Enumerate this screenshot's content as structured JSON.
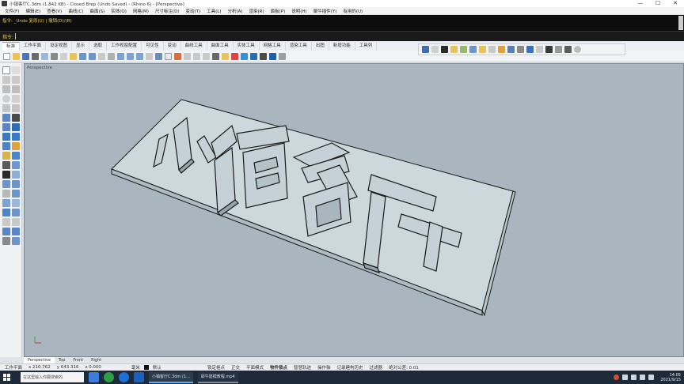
{
  "window": {
    "title": "小镇客厅C.3dm (1.842 KB) - Closed Brep (Undo Saved) - (Rhino 6) - [Perspective]",
    "minimize": "—",
    "maximize": "☐",
    "close": "✕"
  },
  "menu": [
    "文件(F)",
    "编辑(E)",
    "查看(V)",
    "曲线(C)",
    "曲面(S)",
    "实体(O)",
    "网格(M)",
    "尺寸标注(D)",
    "变动(T)",
    "工具(L)",
    "分析(A)",
    "渲染(R)",
    "面板(P)",
    "说明(H)",
    "犀牛插件(Y)",
    "有用的(U)"
  ],
  "command": {
    "history": "指令: _Undo 复原(U) | 撤销(D)/(R)",
    "prompt": "指令:"
  },
  "tabs": [
    "标准",
    "工作平面",
    "设定视图",
    "显示",
    "选取",
    "工作视窗配置",
    "可见性",
    "变动",
    "曲线工具",
    "曲面工具",
    "实体工具",
    "网格工具",
    "渲染工具",
    "出图",
    "新增功能",
    "工具列"
  ],
  "viewport": {
    "label": "Perspective",
    "tabs": [
      "Perspective",
      "Top",
      "Front",
      "Right"
    ]
  },
  "status": {
    "cplane": "工作平面",
    "x": "x 210.762",
    "y": "y 643.316",
    "z": "z 0.000",
    "units": "毫米",
    "layer": "默认",
    "toggles": [
      "锁定格点",
      "正交",
      "平面模式",
      "物件锁点",
      "智慧轨迹",
      "操作轴",
      "记录建构历史",
      "过滤器",
      "绝对公差: 0.01"
    ]
  },
  "taskbar": {
    "search": "在这里输入你要搜索的",
    "apps": [
      "小镇客厅C.3dm (1...",
      "犀牛建模教程.mp4"
    ],
    "clock_time": "14:05",
    "clock_date": "2021/9/15"
  }
}
